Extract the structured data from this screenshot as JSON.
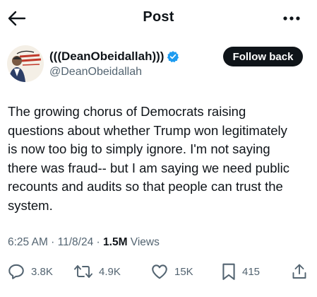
{
  "header": {
    "title": "Post"
  },
  "author": {
    "display_name": "(((DeanObeidallah)))",
    "handle": "@DeanObeidallah",
    "follow_label": "Follow back",
    "verified_color": "#1d9bf0"
  },
  "tweet": {
    "lines": [
      "The growing chorus of Democrats raising",
      "questions about whether Trump won legitimately",
      "is now too big to simply ignore. I'm not saying",
      "there was fraud-- but I am saying we need public",
      "recounts and audits so that people can trust the",
      "system."
    ]
  },
  "meta": {
    "time": "6:25 AM",
    "separator": " · ",
    "date": "11/8/24",
    "views_count": "1.5M",
    "views_label": " Views"
  },
  "actions": {
    "replies": "3.8K",
    "reposts": "4.9K",
    "likes": "15K",
    "bookmarks": "415"
  },
  "icons": {
    "back": "arrow-left-icon",
    "more": "more-horizontal-icon",
    "reply": "reply-icon",
    "repost": "repost-icon",
    "like": "heart-icon",
    "bookmark": "bookmark-icon",
    "share": "share-icon"
  },
  "colors": {
    "text": "#0f1419",
    "secondary": "#536471",
    "accent": "#1d9bf0"
  }
}
